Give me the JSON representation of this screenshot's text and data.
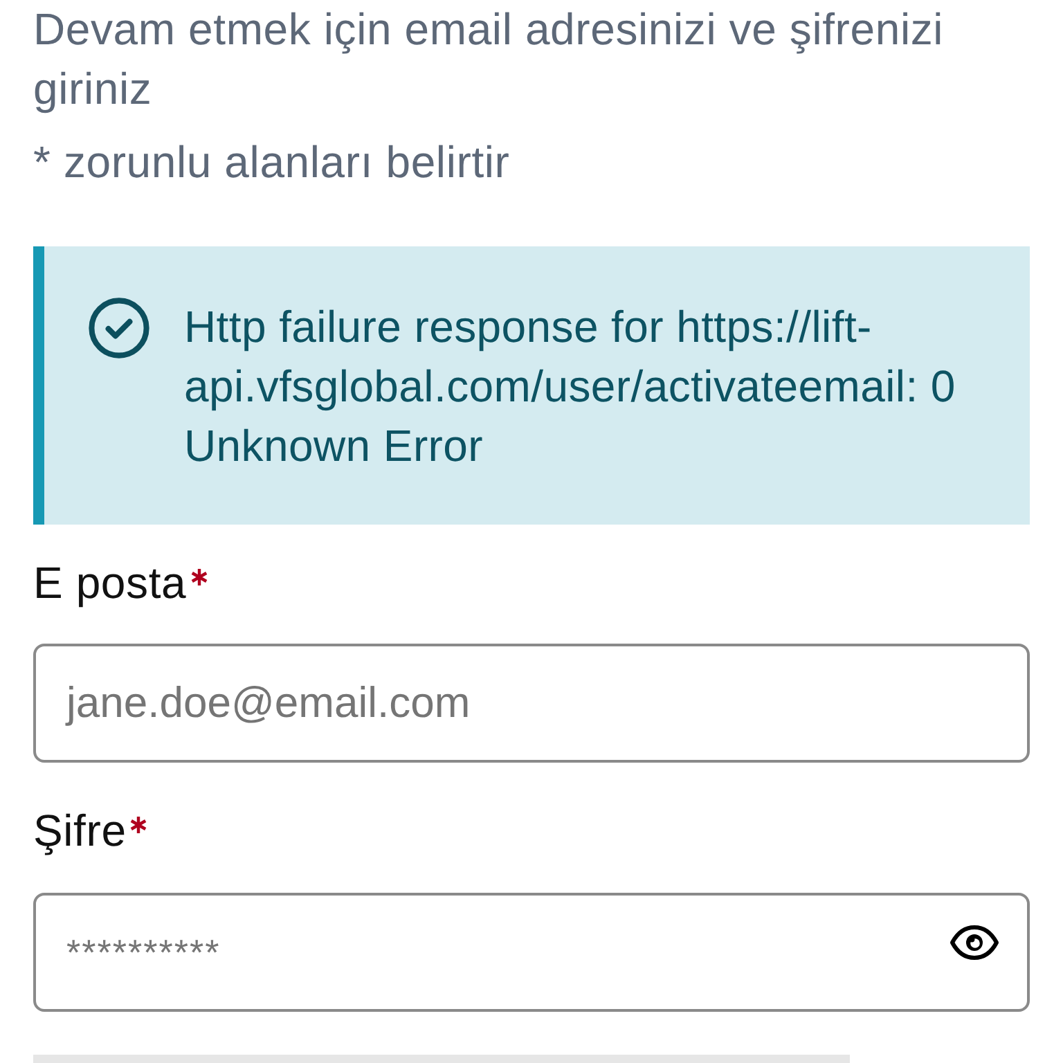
{
  "instructions": "Devam etmek için email adresinizi ve şifrenizi giriniz",
  "required_note": "* zorunlu alanları belirtir",
  "alert": {
    "message": "Http failure response for https://lift-api.vfsglobal.com/user/activateemail: 0 Unknown Error"
  },
  "fields": [
    {
      "kind": "email",
      "label": "E posta",
      "required": true,
      "placeholder": "jane.doe@email.com"
    },
    {
      "kind": "password",
      "label": "Şifre",
      "required": true,
      "placeholder": "**********"
    }
  ]
}
